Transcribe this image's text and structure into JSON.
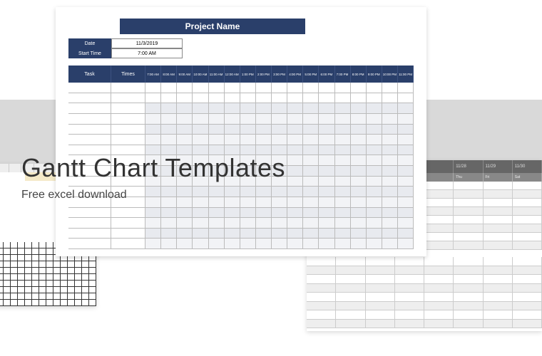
{
  "overlay": {
    "title": "Gantt Chart Templates",
    "subtitle": "Free excel download"
  },
  "main_sheet": {
    "title": "Project Name",
    "info": [
      {
        "label": "Date",
        "value": "11/3/2019"
      },
      {
        "label": "Start Time",
        "value": "7:00 AM"
      }
    ],
    "columns": {
      "task": "Task",
      "times": "Times",
      "slots": [
        "7:00 AM",
        "8:00 AM",
        "9:00 AM",
        "10:00 AM",
        "11:00 AM",
        "12:00 AM",
        "1:00 PM",
        "2:00 PM",
        "3:00 PM",
        "4:00 PM",
        "5:00 PM",
        "6:00 PM",
        "7:00 PM",
        "8:00 PM",
        "9:00 PM",
        "10:00 PM",
        "11:00 PM"
      ]
    },
    "row_count": 16
  },
  "sheet3": {
    "header": [
      "",
      "",
      "",
      "",
      "",
      "11/28",
      "11/29",
      "11/30"
    ],
    "sub": [
      "",
      "",
      "",
      "",
      "",
      "Thu",
      "Fri",
      "Sat"
    ],
    "rows_a": 8,
    "rows_b": 8
  }
}
